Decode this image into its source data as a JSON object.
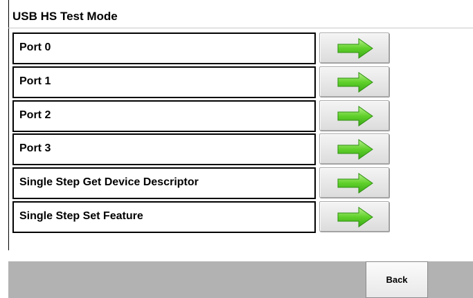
{
  "window": {
    "title": "USB HS Test Mode"
  },
  "items": [
    {
      "label": "Port 0",
      "icon": "green-arrow-right-icon"
    },
    {
      "label": "Port 1",
      "icon": "green-arrow-right-icon"
    },
    {
      "label": "Port 2",
      "icon": "green-arrow-right-icon"
    },
    {
      "label": "Port 3",
      "icon": "green-arrow-right-icon"
    },
    {
      "label": "Single Step Get Device Descriptor",
      "icon": "green-arrow-right-icon"
    },
    {
      "label": "Single Step Set Feature",
      "icon": "green-arrow-right-icon"
    }
  ],
  "footer": {
    "back_label": "Back"
  },
  "colors": {
    "arrow_green": "#4cc820",
    "bottom_bar": "#b2b2b2",
    "button_face": "#e6e6e6"
  }
}
